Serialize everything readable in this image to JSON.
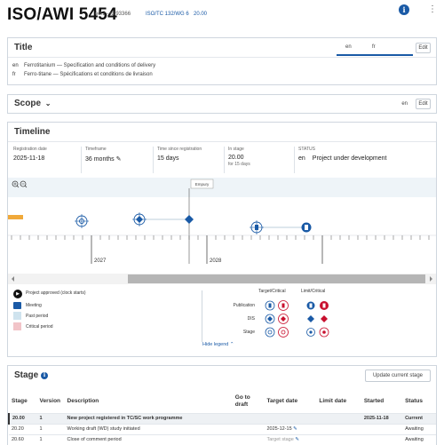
{
  "header": {
    "title": "ISO/AWI 5454",
    "meta": "ed.2 - id.93366",
    "committee": "ISO/TC 132/WG 6",
    "stage": "20.00"
  },
  "title_panel": {
    "heading": "Title",
    "tabs": [
      "en",
      "fr"
    ],
    "edit_label": "Edit",
    "rows": [
      {
        "lang": "en",
        "text": "Ferrotitanium — Specification and conditions of delivery"
      },
      {
        "lang": "fr",
        "text": "Ferro-titane — Spécifications et conditions de livraison"
      }
    ]
  },
  "scope_panel": {
    "heading": "Scope",
    "lang": "en",
    "edit_label": "Edit"
  },
  "timeline": {
    "heading": "Timeline",
    "registration_label": "Registration date",
    "registration_value": "2025-11-18",
    "timeframe_label": "Timeframe",
    "timeframe_value": "36 months",
    "since_label": "Time since registration",
    "since_value": "15 days",
    "instage_label": "In stage",
    "instage_value": "20.00",
    "instage_sub": "for 15 days",
    "status_label": "STATUS",
    "status_lang": "en",
    "status_value": "Project under development",
    "today_label": "Empury",
    "year_labels": [
      "2027",
      "2028"
    ],
    "legend_left": [
      "Project approved (clock starts)",
      "Meeting",
      "Past period",
      "Critical period"
    ],
    "legend_col_headers": [
      "Target/Critical",
      "Limit/Critical"
    ],
    "legend_rows": [
      "Publication",
      "DIS",
      "Stage"
    ],
    "hide_legend": "Hide legend"
  },
  "stage_panel": {
    "heading": "Stage",
    "update_label": "Update current stage",
    "columns": [
      "Stage",
      "Version",
      "Description",
      "Go to draft",
      "Target date",
      "Limit date",
      "Started",
      "Status"
    ],
    "rows": [
      {
        "stage": "20.00",
        "version": "1",
        "description": "New project registered in TC/SC work programme",
        "target": "",
        "limit": "",
        "started": "2025-11-18",
        "status": "Current"
      },
      {
        "stage": "20.20",
        "version": "1",
        "description": "Working draft (WD) study initiated",
        "target": "2025-12-15",
        "limit": "",
        "started": "",
        "status": "Awaiting"
      },
      {
        "stage": "20.60",
        "version": "1",
        "description": "Close of comment period",
        "target": "Target stage",
        "limit": "",
        "started": "",
        "status": "Awaiting"
      }
    ]
  },
  "colors": {
    "accent": "#1a5aa6",
    "critical": "#c8102e",
    "past_period": "#cfe3ee",
    "critical_period": "#f2c4c8"
  }
}
